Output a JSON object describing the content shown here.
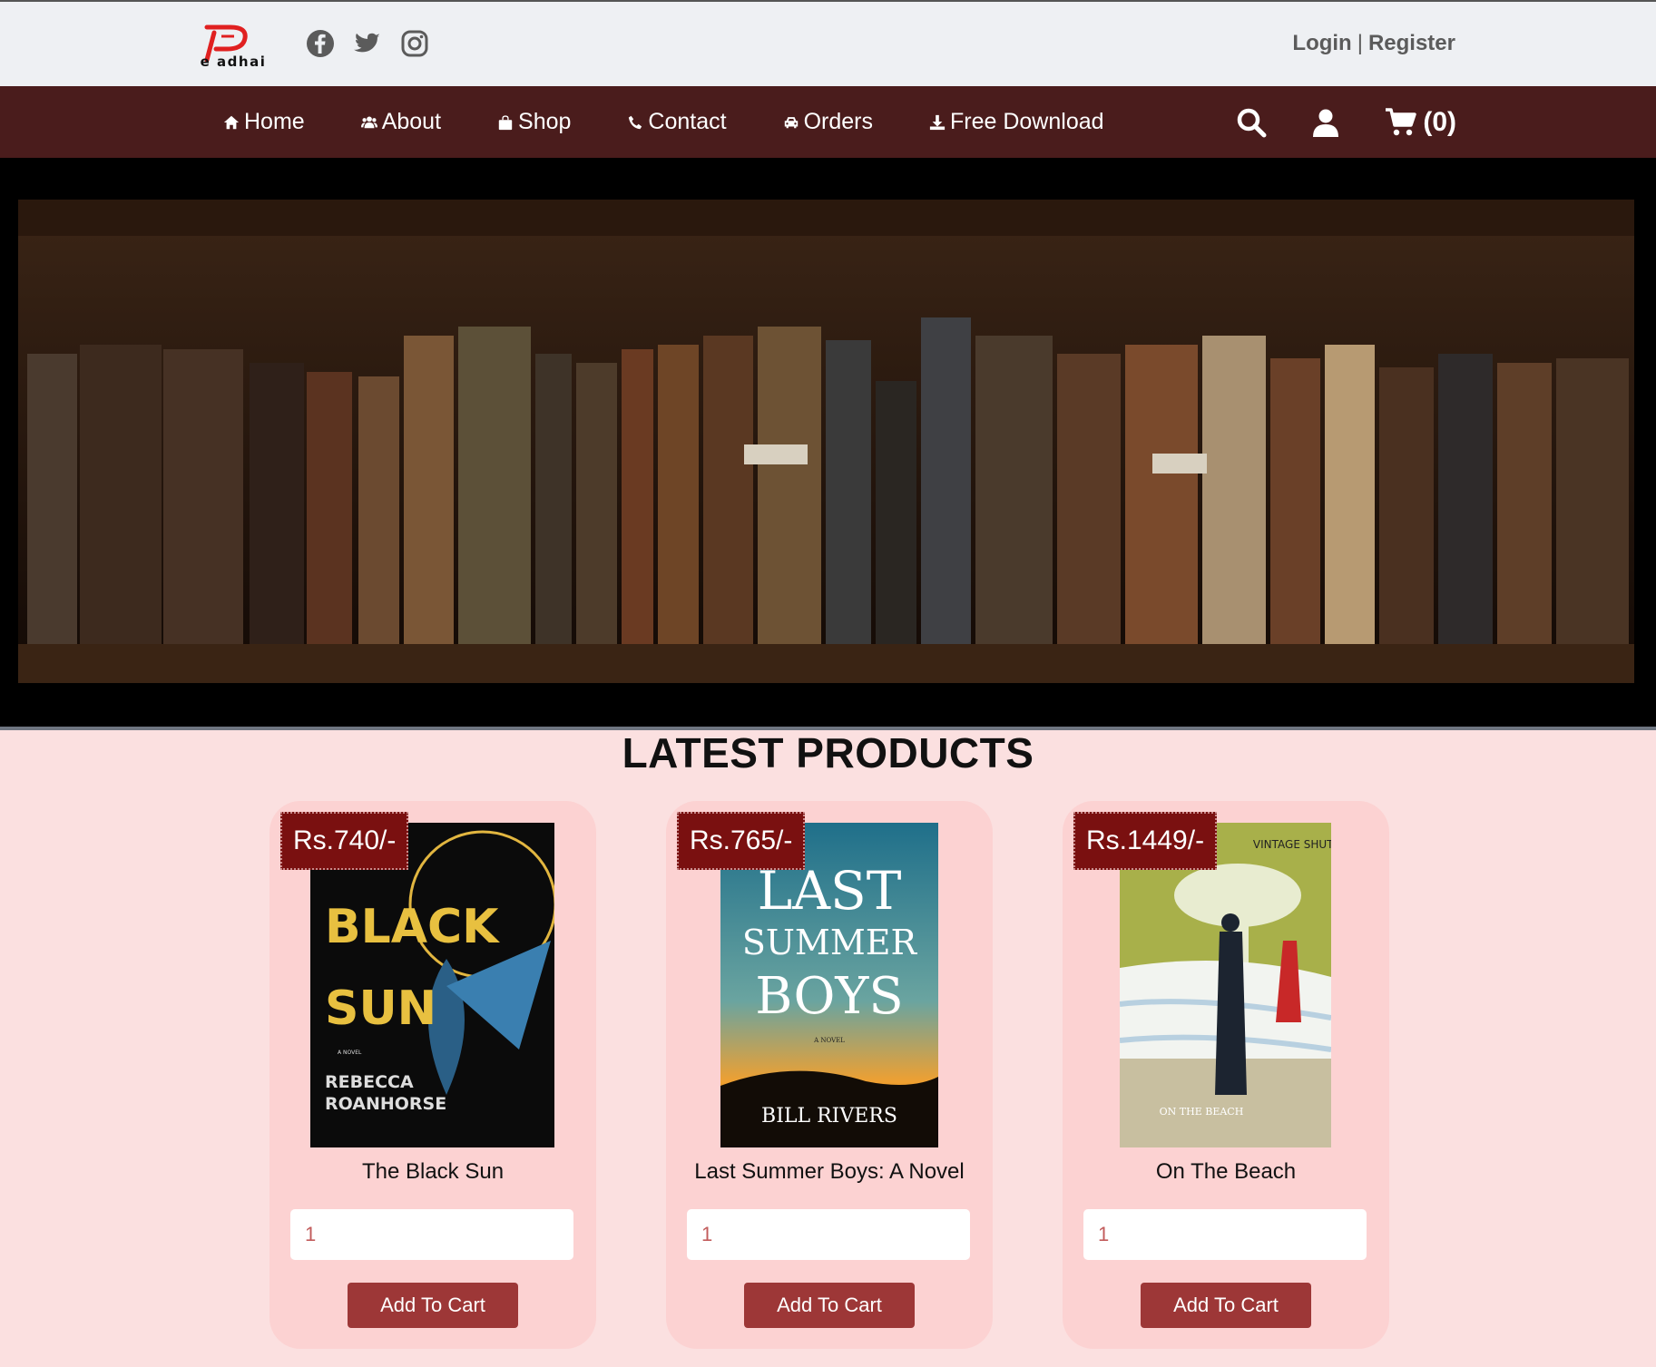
{
  "brand": {
    "logo_text": "e adhai"
  },
  "social": [
    {
      "icon": "facebook-icon"
    },
    {
      "icon": "twitter-icon"
    },
    {
      "icon": "instagram-icon"
    }
  ],
  "auth": {
    "login": "Login",
    "separator": "|",
    "register": "Register"
  },
  "nav": {
    "items": [
      {
        "label": "Home",
        "icon": "home-icon"
      },
      {
        "label": "About",
        "icon": "users-icon"
      },
      {
        "label": "Shop",
        "icon": "shopping-bag-icon"
      },
      {
        "label": "Contact",
        "icon": "phone-icon"
      },
      {
        "label": "Orders",
        "icon": "car-icon"
      },
      {
        "label": "Free Download",
        "icon": "download-icon"
      }
    ],
    "cart_count": "(0)"
  },
  "section": {
    "title": "LATEST PRODUCTS"
  },
  "products": [
    {
      "price": "Rs.740/-",
      "name": "The Black Sun",
      "qty": "1",
      "button": "Add To Cart",
      "cover": {
        "line1": "BLACK",
        "line2": "SUN",
        "small": "A NOVEL",
        "author1": "REBECCA",
        "author2": "ROANHORSE"
      }
    },
    {
      "price": "Rs.765/-",
      "name": "Last Summer Boys: A Novel",
      "qty": "1",
      "button": "Add To Cart",
      "cover": {
        "line1": "LAST",
        "line2": "SUMMER",
        "line3": "BOYS",
        "small": "A NOVEL",
        "author": "BILL RIVERS"
      }
    },
    {
      "price": "Rs.1449/-",
      "name": "On The Beach",
      "qty": "1",
      "button": "Add To Cart",
      "cover": {
        "top": "VINTAGE SHUTE",
        "bottom": "ON THE BEACH"
      }
    }
  ]
}
